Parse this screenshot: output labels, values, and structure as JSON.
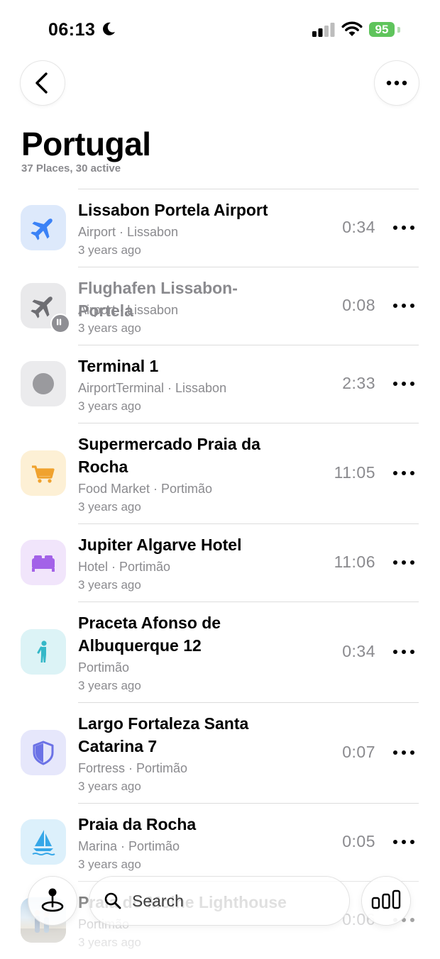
{
  "status_bar": {
    "time": "06:13",
    "battery": "95"
  },
  "header": {
    "title": "Portugal",
    "subtitle": "37 Places, 30 active"
  },
  "places": [
    {
      "name": "Lissabon Portela Airport",
      "meta": "Airport · Lissabon",
      "ago": "3 years ago",
      "duration": "0:34",
      "icon": "airplane-icon",
      "icon_color": "#3b82f6",
      "bg_color": "#dde9fb"
    },
    {
      "name": "Flughafen Lissabon-Portela",
      "meta": "Airport · Lissabon",
      "ago": "3 years ago",
      "duration": "0:08",
      "icon": "airplane-icon",
      "icon_color": "#6e6e73",
      "bg_color": "#e9e9eb",
      "paused": true
    },
    {
      "name": "Terminal 1",
      "meta": "AirportTerminal · Lissabon",
      "ago": "3 years ago",
      "duration": "2:33",
      "icon": "circle-icon",
      "icon_color": "#9a9a9e",
      "bg_color": "#ebebed"
    },
    {
      "name": "Supermercado Praia da Rocha",
      "meta": "Food Market · Portimão",
      "ago": "3 years ago",
      "duration": "11:05",
      "icon": "cart-icon",
      "icon_color": "#f0a22e",
      "bg_color": "#fdf0d5"
    },
    {
      "name": "Jupiter Algarve Hotel",
      "meta": "Hotel · Portimão",
      "ago": "3 years ago",
      "duration": "11:06",
      "icon": "bed-icon",
      "icon_color": "#a362e8",
      "bg_color": "#f1e5fb"
    },
    {
      "name": "Praceta Afonso de Albuquerque 12",
      "meta": "Portimão",
      "ago": "3 years ago",
      "duration": "0:34",
      "icon": "person-icon",
      "icon_color": "#35b8c8",
      "bg_color": "#dcf3f6"
    },
    {
      "name": "Largo Fortaleza Santa Catarina 7",
      "meta": "Fortress · Portimão",
      "ago": "3 years ago",
      "duration": "0:07",
      "icon": "shield-icon",
      "icon_color": "#6b72e6",
      "bg_color": "#e6e7fb"
    },
    {
      "name": "Praia da Rocha",
      "meta": "Marina · Portimão",
      "ago": "3 years ago",
      "duration": "0:05",
      "icon": "sailboat-icon",
      "icon_color": "#36a7e8",
      "bg_color": "#dcf0fb"
    },
    {
      "name": "Praia do Molhe Lighthouse",
      "meta": "Portimão",
      "ago": "3 years ago",
      "duration": "0:06",
      "icon": "photo-thumbnail",
      "photo": true
    }
  ],
  "bottom_bar": {
    "search_placeholder": "Search"
  }
}
